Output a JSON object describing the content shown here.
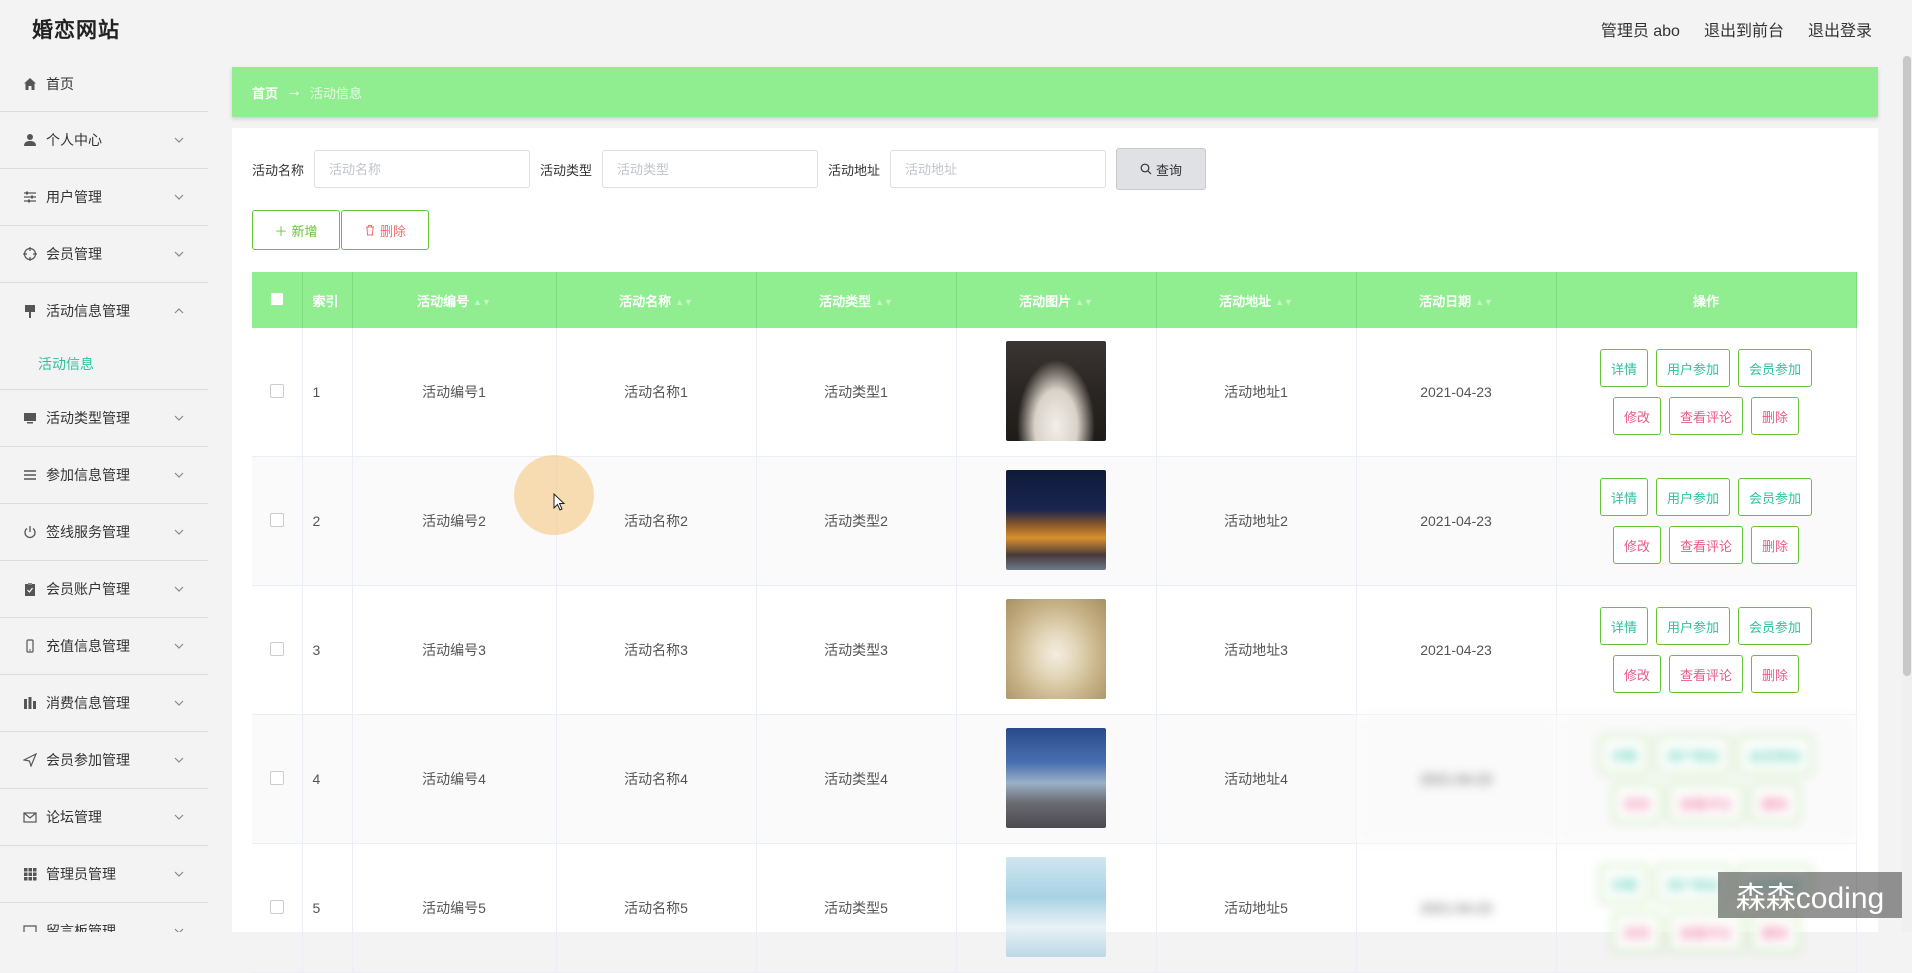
{
  "brand": "婚恋网站",
  "header": {
    "admin_label": "管理员 abo",
    "to_front": "退出到前台",
    "logout": "退出登录"
  },
  "sidebar": {
    "items": [
      {
        "label": "首页",
        "icon": "home-icon"
      },
      {
        "label": "个人中心",
        "icon": "user-icon"
      },
      {
        "label": "用户管理",
        "icon": "sliders-icon"
      },
      {
        "label": "会员管理",
        "icon": "target-icon"
      },
      {
        "label": "活动信息管理",
        "icon": "pin-icon",
        "expanded": true
      },
      {
        "label": "活动类型管理",
        "icon": "monitor-icon"
      },
      {
        "label": "参加信息管理",
        "icon": "list-icon"
      },
      {
        "label": "签线服务管理",
        "icon": "power-icon"
      },
      {
        "label": "会员账户管理",
        "icon": "clipboard-icon"
      },
      {
        "label": "充值信息管理",
        "icon": "phone-icon"
      },
      {
        "label": "消费信息管理",
        "icon": "bar-chart-icon"
      },
      {
        "label": "会员参加管理",
        "icon": "send-icon"
      },
      {
        "label": "论坛管理",
        "icon": "mail-icon"
      },
      {
        "label": "管理员管理",
        "icon": "grid-icon"
      },
      {
        "label": "留言板管理",
        "icon": "message-icon"
      }
    ],
    "sub_active": "活动信息"
  },
  "breadcrumb": {
    "home": "首页",
    "arrow": "→",
    "current": "活动信息"
  },
  "search": {
    "name_label": "活动名称",
    "name_placeholder": "活动名称",
    "type_label": "活动类型",
    "type_placeholder": "活动类型",
    "addr_label": "活动地址",
    "addr_placeholder": "活动地址",
    "button": "查询"
  },
  "actions": {
    "add": "新增",
    "delete": "删除"
  },
  "table": {
    "headers": [
      "索引",
      "活动编号",
      "活动名称",
      "活动类型",
      "活动图片",
      "活动地址",
      "活动日期",
      "操作"
    ],
    "rows": [
      {
        "index": "1",
        "code": "活动编号1",
        "name": "活动名称1",
        "type": "活动类型1",
        "addr": "活动地址1",
        "date": "2021-04-23"
      },
      {
        "index": "2",
        "code": "活动编号2",
        "name": "活动名称2",
        "type": "活动类型2",
        "addr": "活动地址2",
        "date": "2021-04-23"
      },
      {
        "index": "3",
        "code": "活动编号3",
        "name": "活动名称3",
        "type": "活动类型3",
        "addr": "活动地址3",
        "date": "2021-04-23"
      },
      {
        "index": "4",
        "code": "活动编号4",
        "name": "活动名称4",
        "type": "活动类型4",
        "addr": "活动地址4",
        "date": "2021-04-23"
      },
      {
        "index": "5",
        "code": "活动编号5",
        "name": "活动名称5",
        "type": "活动类型5",
        "addr": "活动地址5",
        "date": "2021-04-23"
      }
    ],
    "ops": {
      "detail": "详情",
      "user_join": "用户参加",
      "member_join": "会员参加",
      "edit": "修改",
      "comments": "查看评论",
      "delete": "删除"
    }
  },
  "watermark": "森森coding",
  "colors": {
    "accent": "#90ee90",
    "teal": "#2ec1a0",
    "pink": "#e85a8a",
    "border_green": "#67c23a"
  }
}
